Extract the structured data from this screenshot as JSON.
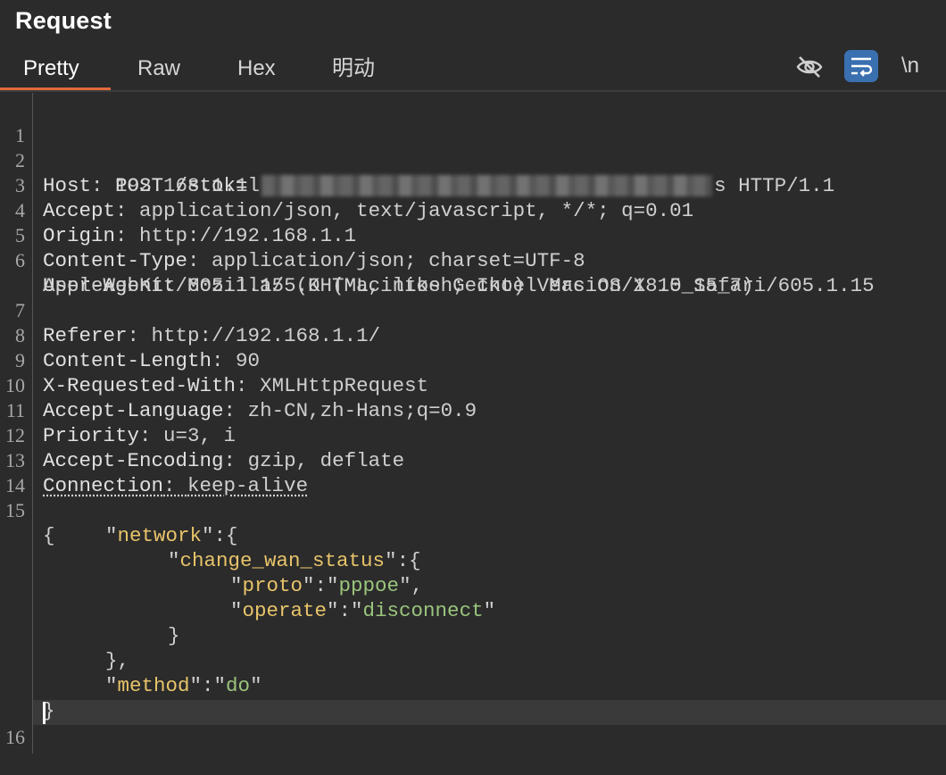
{
  "panel": {
    "title": "Request"
  },
  "tabs": [
    {
      "label": "Pretty",
      "active": true
    },
    {
      "label": "Raw",
      "active": false
    },
    {
      "label": "Hex",
      "active": false
    },
    {
      "label": "明动",
      "active": false
    }
  ],
  "toolbar": {
    "hide_icon": "eye-slash-icon",
    "wrap_icon": "word-wrap-icon",
    "newline_label": "\\n"
  },
  "colors": {
    "accent": "#e06a3c",
    "wrap_active": "#3a6fb0",
    "json_key": "#e8c46a",
    "json_value": "#9ac57d"
  },
  "editor": {
    "request_line": {
      "method_path_prefix": "POST /stok=",
      "first_char": "l",
      "last_char": "s",
      "protocol": " HTTP/1.1"
    },
    "headers": [
      {
        "name": "Host",
        "value": "192.168.1.1"
      },
      {
        "name": "Accept",
        "value": "application/json, text/javascript, */*; q=0.01"
      },
      {
        "name": "Origin",
        "value": "http://192.168.1.1"
      },
      {
        "name": "Content-Type",
        "value": "application/json; charset=UTF-8"
      },
      {
        "name": "User-Agent",
        "value": "Mozilla/5.0 (Macintosh; Intel Mac OS X 10_15_7)",
        "value_wrap": "AppleWebKit/605.1.15 (KHTML, like Gecko) Version/18.5 Safari/605.1.15"
      },
      {
        "name": "Referer",
        "value": "http://192.168.1.1/"
      },
      {
        "name": "Content-Length",
        "value": "90"
      },
      {
        "name": "X-Requested-With",
        "value": "XMLHttpRequest"
      },
      {
        "name": "Accept-Language",
        "value": "zh-CN,zh-Hans;q=0.9"
      },
      {
        "name": "Priority",
        "value": "u=3, i"
      },
      {
        "name": "Accept-Encoding",
        "value": "gzip, deflate"
      },
      {
        "name": "Connection",
        "value": "keep-alive"
      }
    ],
    "body": {
      "key_network": "network",
      "key_change_wan_status": "change_wan_status",
      "key_proto": "proto",
      "val_proto": "pppoe",
      "key_operate": "operate",
      "val_operate": "disconnect",
      "key_method": "method",
      "val_method": "do"
    },
    "line_numbers": [
      "1",
      "2",
      "3",
      "4",
      "5",
      "6",
      "7",
      "8",
      "9",
      "10",
      "11",
      "12",
      "13",
      "14",
      "15",
      "16"
    ]
  }
}
